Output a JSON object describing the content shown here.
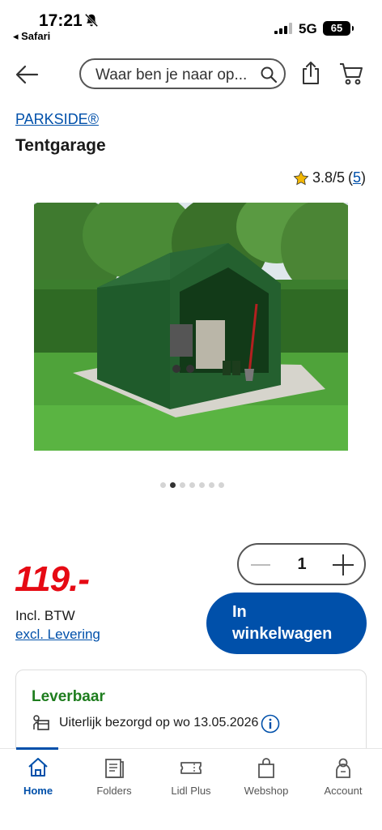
{
  "status_bar": {
    "time": "17:21",
    "back_app": "◂ Safari",
    "network": "5G",
    "battery": "65"
  },
  "header": {
    "search_placeholder": "Waar ben je naar op..."
  },
  "product": {
    "brand": "PARKSIDE®",
    "title": "Tentgarage",
    "rating": "3.8/5",
    "rating_count": "5",
    "price": "119.-",
    "incl_tax": "Incl. BTW",
    "excl_delivery": "excl. Levering",
    "quantity": "1",
    "add_to_cart_line1": "In",
    "add_to_cart_line2": "winkelwagen",
    "image_count": 7,
    "image_active_index": 1
  },
  "availability": {
    "status": "Leverbaar",
    "delivery_text": "Uiterlijk bezorgd op wo 13.05.2026"
  },
  "bottom_nav": {
    "items": [
      {
        "label": "Home",
        "icon": "home-icon",
        "active": true
      },
      {
        "label": "Folders",
        "icon": "folders-icon",
        "active": false
      },
      {
        "label": "Lidl Plus",
        "icon": "ticket-icon",
        "active": false
      },
      {
        "label": "Webshop",
        "icon": "bag-icon",
        "active": false
      },
      {
        "label": "Account",
        "icon": "account-icon",
        "active": false
      }
    ]
  },
  "colors": {
    "accent": "#0050aa",
    "price": "#e60a14",
    "available": "#1e7d1e"
  }
}
